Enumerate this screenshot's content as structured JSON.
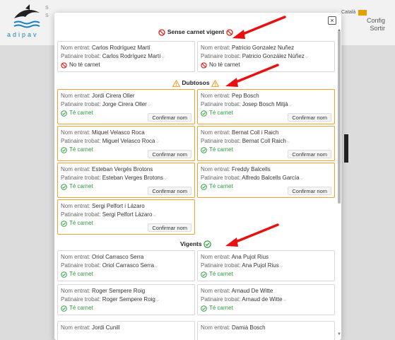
{
  "background": {
    "logo_text": "adipav",
    "letters": [
      "S",
      "S"
    ],
    "language": "Català",
    "config_label": "Config",
    "logout_label": "Sortir"
  },
  "modal": {
    "close_label": "×",
    "sections": {
      "no_license": {
        "title": "Sense carnet vigent"
      },
      "doubtful": {
        "title": "Dubtosos"
      },
      "valid": {
        "title": "Vigents"
      }
    },
    "labels": {
      "entered_name": "Nom entrat:",
      "found_skater": "Patinaire trobat:",
      "no_license": "No té carnet",
      "has_license": "Té carnet",
      "confirm": "Confirmar nom"
    },
    "no_license_cards": [
      {
        "entered": "Carlos Rodríguez Martí",
        "found": "Carlos Rodríguez Martí"
      },
      {
        "entered": "Patricio Gonzalez Nuñez",
        "found": "Patricio González Núñez"
      }
    ],
    "doubtful_cards": [
      {
        "entered": "Jordi Cirera Oller",
        "found": "Jorge Cirera Oller"
      },
      {
        "entered": "Pep Bosch",
        "found": "Josep Bosch Mitjà"
      },
      {
        "entered": "Miquel Velasco Roca",
        "found": "Miguel Velasco Roca"
      },
      {
        "entered": "Bernat Coll i Raich",
        "found": "Bernat Coll Raich"
      },
      {
        "entered": "Esteban Vergés Brotons",
        "found": "Esteban Verges Brotons"
      },
      {
        "entered": "Freddy Balcells",
        "found": "Alfredo Balcells García"
      },
      {
        "entered": "Sergi Pelfort i Lázaro",
        "found": "Sergi Pelfort Lázaro"
      }
    ],
    "valid_cards": [
      {
        "entered": "Oriol Carrasco Serra",
        "found": "Oriol Carrasco Serra"
      },
      {
        "entered": "Ana Pujol Rius",
        "found": "Ana Pujol Rius"
      },
      {
        "entered": "Roger Sempere Roig",
        "found": "Roger Sempere Roig"
      },
      {
        "entered": "Arnaud De Witte",
        "found": "Arnaud de Witte"
      },
      {
        "entered": "Jordi Cunill",
        "found": ""
      },
      {
        "entered": "Damià Bosch",
        "found": ""
      }
    ]
  },
  "colors": {
    "warning": "#f0a030",
    "error": "#e02020",
    "success": "#2a9a3a",
    "annotation_arrow": "#e81010"
  }
}
